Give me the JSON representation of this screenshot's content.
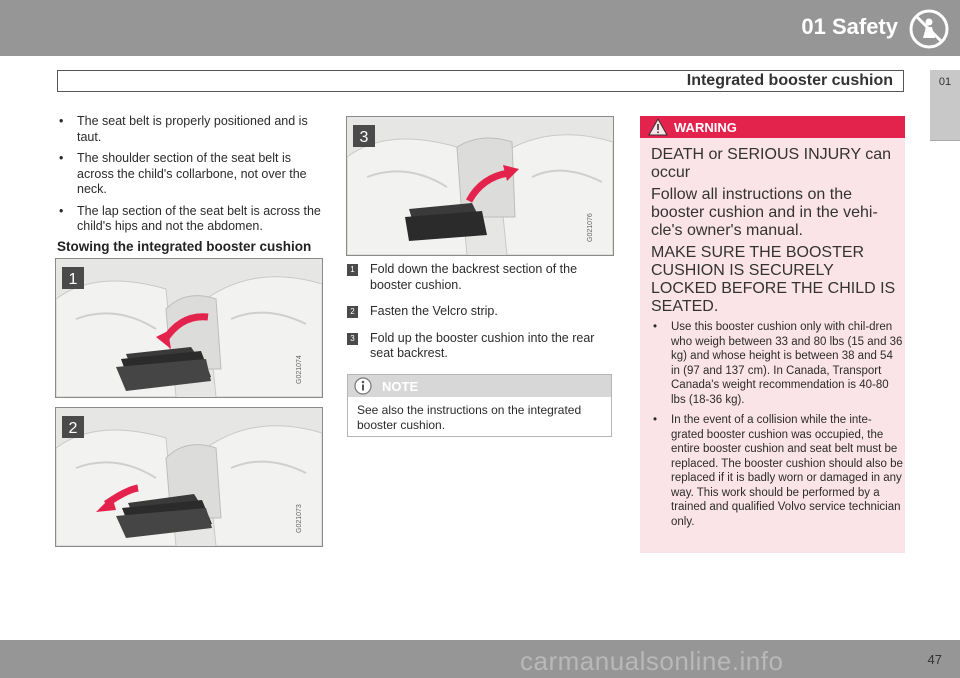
{
  "header": {
    "chapter": "01 Safety",
    "section": "Integrated booster cushion",
    "side_tab": "01"
  },
  "left_column": {
    "bullets": [
      "The seat belt is properly positioned and is taut.",
      "The shoulder section of the seat belt is across the child's collarbone, not over the neck.",
      "The lap section of the seat belt is across the child's hips and not the abdomen."
    ],
    "subheading": "Stowing the integrated booster cushion"
  },
  "figures": [
    {
      "label": "1",
      "code": "G021074"
    },
    {
      "label": "2",
      "code": "G021073"
    },
    {
      "label": "3",
      "code": "G021076"
    }
  ],
  "steps": [
    {
      "num": "1",
      "text": "Fold down the backrest section of the booster cushion."
    },
    {
      "num": "2",
      "text": "Fasten the Velcro strip."
    },
    {
      "num": "3",
      "text": "Fold up the booster cushion into the rear seat backrest."
    }
  ],
  "note": {
    "title": "NOTE",
    "text": "See also the instructions on the integrated booster cushion."
  },
  "warning": {
    "title": "WARNING",
    "line1": "DEATH or SERIOUS INJURY can occur",
    "line2": "Follow all instructions on the booster cushion and in the vehi-cle's owner's manual.",
    "line3": "MAKE SURE THE BOOSTER CUSHION IS SECURELY LOCKED BEFORE THE CHILD IS SEATED.",
    "bullets": [
      "Use this booster cushion only with chil-dren who weigh between 33 and 80 lbs (15 and 36 kg) and whose height is between 38 and 54 in (97 and 137 cm). In Canada, Transport Canada's weight recommendation is 40-80 lbs (18-36 kg).",
      "In the event of a collision while the inte-grated booster cushion was occupied, the entire booster cushion and seat belt must be replaced. The booster cushion should also be replaced if it is badly worn or damaged in any way. This work should be performed by a trained and qualified Volvo service technician only."
    ]
  },
  "footer": {
    "page": "47",
    "watermark": "carmanualsonline.info"
  },
  "colors": {
    "header_gray": "#969696",
    "warning_red": "#e4234d",
    "warning_bg": "#fbe4e8",
    "arrow_red": "#e4234d"
  }
}
